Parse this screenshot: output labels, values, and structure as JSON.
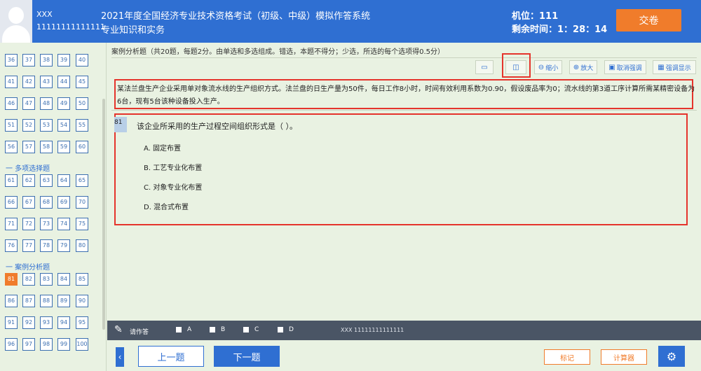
{
  "header": {
    "user_name": "XXX",
    "user_id": "11111111111111",
    "exam_title": "2021年度全国经济专业技术资格考试（初级、中级）模拟作答系统",
    "exam_subject": "专业知识和实务",
    "seat": "机位：111",
    "timer": "剩余时间：1：28：14",
    "submit_label": "交卷"
  },
  "sidebar": {
    "rows_top": [
      [
        "36",
        "37",
        "38",
        "39",
        "40"
      ],
      [
        "41",
        "42",
        "43",
        "44",
        "45"
      ],
      [
        "46",
        "47",
        "48",
        "49",
        "50"
      ],
      [
        "51",
        "52",
        "53",
        "54",
        "55"
      ],
      [
        "56",
        "57",
        "58",
        "59",
        "60"
      ]
    ],
    "section_multi": "一  多项选择题",
    "rows_multi": [
      [
        "61",
        "62",
        "63",
        "64",
        "65"
      ],
      [
        "66",
        "67",
        "68",
        "69",
        "70"
      ],
      [
        "71",
        "72",
        "73",
        "74",
        "75"
      ],
      [
        "76",
        "77",
        "78",
        "79",
        "80"
      ]
    ],
    "section_case": "一  案例分析题",
    "rows_case": [
      [
        "81",
        "82",
        "83",
        "84",
        "85"
      ],
      [
        "86",
        "87",
        "88",
        "89",
        "90"
      ],
      [
        "91",
        "92",
        "93",
        "94",
        "95"
      ],
      [
        "96",
        "97",
        "98",
        "99",
        "100"
      ]
    ],
    "current": "81"
  },
  "main": {
    "instructions": "案例分析题（共20题，每题2分。由单选和多选组成。错选，本题不得分；少选，所选的每个选项得0.5分）",
    "toolbar": {
      "shrink": "缩小",
      "enlarge": "放大",
      "cancel_emphasis": "取消强调",
      "emphasis": "强调显示"
    },
    "case_text": "某法兰盘生产企业采用单对象流水线的生产组织方式。法兰盘的日生产量为50件，每日工作8小时，时间有效利用系数为0.90，假设废品率为0；流水线的第3道工序计算所需某精密设备为6台，现有5台该种设备投入生产。",
    "question_number": "81",
    "question_text": "该企业所采用的生产过程空间组织形式是（ ）。",
    "options": [
      "A. 固定布置",
      "B. 工艺专业化布置",
      "C. 对象专业化布置",
      "D. 混合式布置"
    ]
  },
  "answer_bar": {
    "prompt": "请作答",
    "choices": [
      "A",
      "B",
      "C",
      "D"
    ],
    "user": "XXX 11111111111111"
  },
  "bottom": {
    "prev": "上一题",
    "next": "下一题",
    "mark": "标记",
    "calculator": "计算器"
  },
  "colors": {
    "header_blue": "#2f6fd2",
    "accent_orange": "#f07c2b",
    "background_green": "#e9f2e2",
    "highlight_red": "#e5342c"
  },
  "icons": {
    "single_pane": "single-pane-icon",
    "split_pane": "split-pane-icon",
    "shrink": "zoom-out-icon",
    "enlarge": "zoom-in-icon",
    "pencil": "pencil-icon",
    "settings": "gear-icon"
  }
}
